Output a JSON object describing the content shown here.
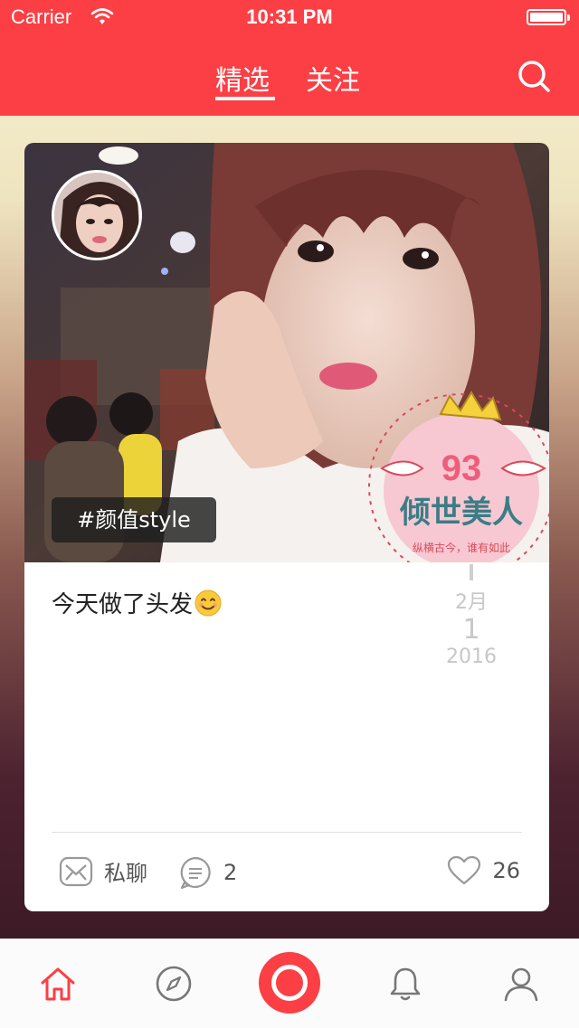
{
  "status": {
    "carrier": "Carrier",
    "time": "10:31 PM"
  },
  "nav": {
    "tabs": [
      "精选",
      "关注"
    ],
    "active_tab": "精选"
  },
  "post": {
    "tag": "#颜值style",
    "text": "今天做了头发",
    "date": {
      "month": "2月",
      "day": "1",
      "year": "2016"
    },
    "sticker": {
      "number": "93",
      "title": "倾世美人",
      "subtitle": "纵横古今，谁有如此"
    },
    "actions": {
      "message_label": "私聊",
      "comment_count": "2",
      "like_count": "26"
    }
  },
  "colors": {
    "accent": "#fb3f45",
    "muted": "#c7c7c7"
  },
  "icons": {
    "nav": [
      "search-icon"
    ],
    "card": [
      "envelope-icon",
      "comment-icon",
      "heart-icon",
      "smile-emoji"
    ],
    "tabbar": [
      "home-icon",
      "compass-icon",
      "record-icon",
      "bell-icon",
      "profile-icon"
    ]
  }
}
